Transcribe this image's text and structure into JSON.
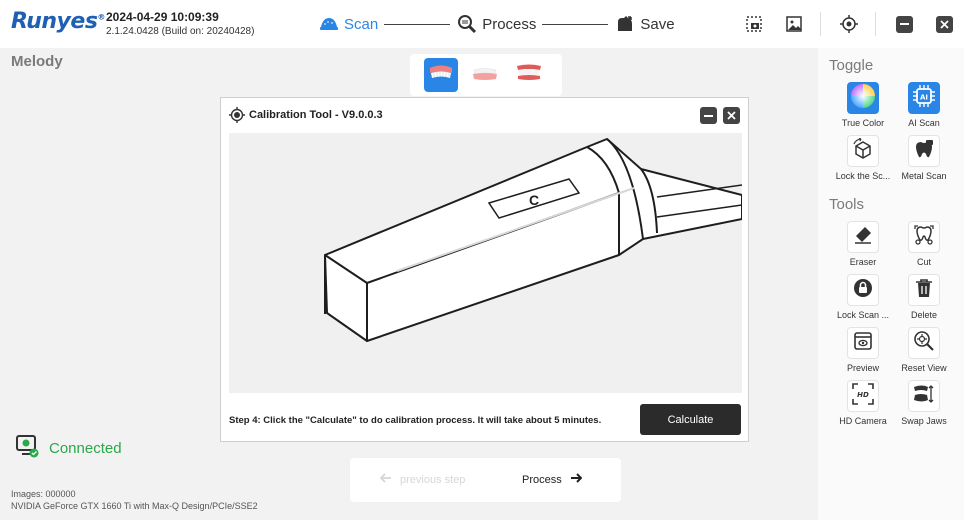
{
  "app": {
    "logo": "Runyes",
    "logo_mark": "®",
    "datetime": "2024-04-29 10:09:39",
    "build": "2.1.24.0428 (Build on: 20240428)"
  },
  "workflow": {
    "steps": [
      {
        "label": "Scan",
        "active": true,
        "icon": "scan-icon"
      },
      {
        "label": "Process",
        "active": false,
        "icon": "process-icon"
      },
      {
        "label": "Save",
        "active": false,
        "icon": "save-icon"
      }
    ]
  },
  "top_icons": [
    "screenshot-icon",
    "gallery-icon",
    "target-icon",
    "minimize-icon",
    "close-icon"
  ],
  "user": {
    "name": "Melody"
  },
  "jaws": [
    {
      "icon": "upper-jaw-icon",
      "active": true
    },
    {
      "icon": "lower-jaw-icon",
      "active": false
    },
    {
      "icon": "bite-jaw-icon",
      "active": false
    }
  ],
  "dialog": {
    "title": "Calibration Tool - V9.0.0.3",
    "instruction": "Step 4: Click the \"Calculate\" to do calibration process. It will take about 5 minutes.",
    "calculate_label": "Calculate",
    "device_mark": "C"
  },
  "status": {
    "connected": "Connected",
    "images": "Images: 000000",
    "gpu": "NVIDIA GeForce GTX 1660 Ti with Max-Q Design/PCIe/SSE2"
  },
  "bottom_nav": {
    "previous_label": "previous step",
    "next_label": "Process"
  },
  "right_panel": {
    "toggle_title": "Toggle",
    "tools_title": "Tools",
    "toggle_items": [
      {
        "label": "True Color",
        "icon": "true-color-icon"
      },
      {
        "label": "AI Scan",
        "icon": "ai-scan-icon"
      },
      {
        "label": "Lock the Sc...",
        "icon": "lock-scan-cube-icon"
      },
      {
        "label": "Metal Scan",
        "icon": "metal-scan-icon"
      }
    ],
    "tool_items": [
      {
        "label": "Eraser",
        "icon": "eraser-icon"
      },
      {
        "label": "Cut",
        "icon": "cut-icon"
      },
      {
        "label": "Lock Scan ...",
        "icon": "lock-scan-icon"
      },
      {
        "label": "Delete",
        "icon": "delete-icon"
      },
      {
        "label": "Preview",
        "icon": "preview-icon"
      },
      {
        "label": "Reset View",
        "icon": "reset-view-icon"
      },
      {
        "label": "HD Camera",
        "icon": "hd-camera-icon"
      },
      {
        "label": "Swap Jaws",
        "icon": "swap-jaws-icon"
      }
    ]
  },
  "colors": {
    "accent": "#2a86e6",
    "connected": "#2aa84a",
    "dark_button": "#2b2b2b"
  }
}
